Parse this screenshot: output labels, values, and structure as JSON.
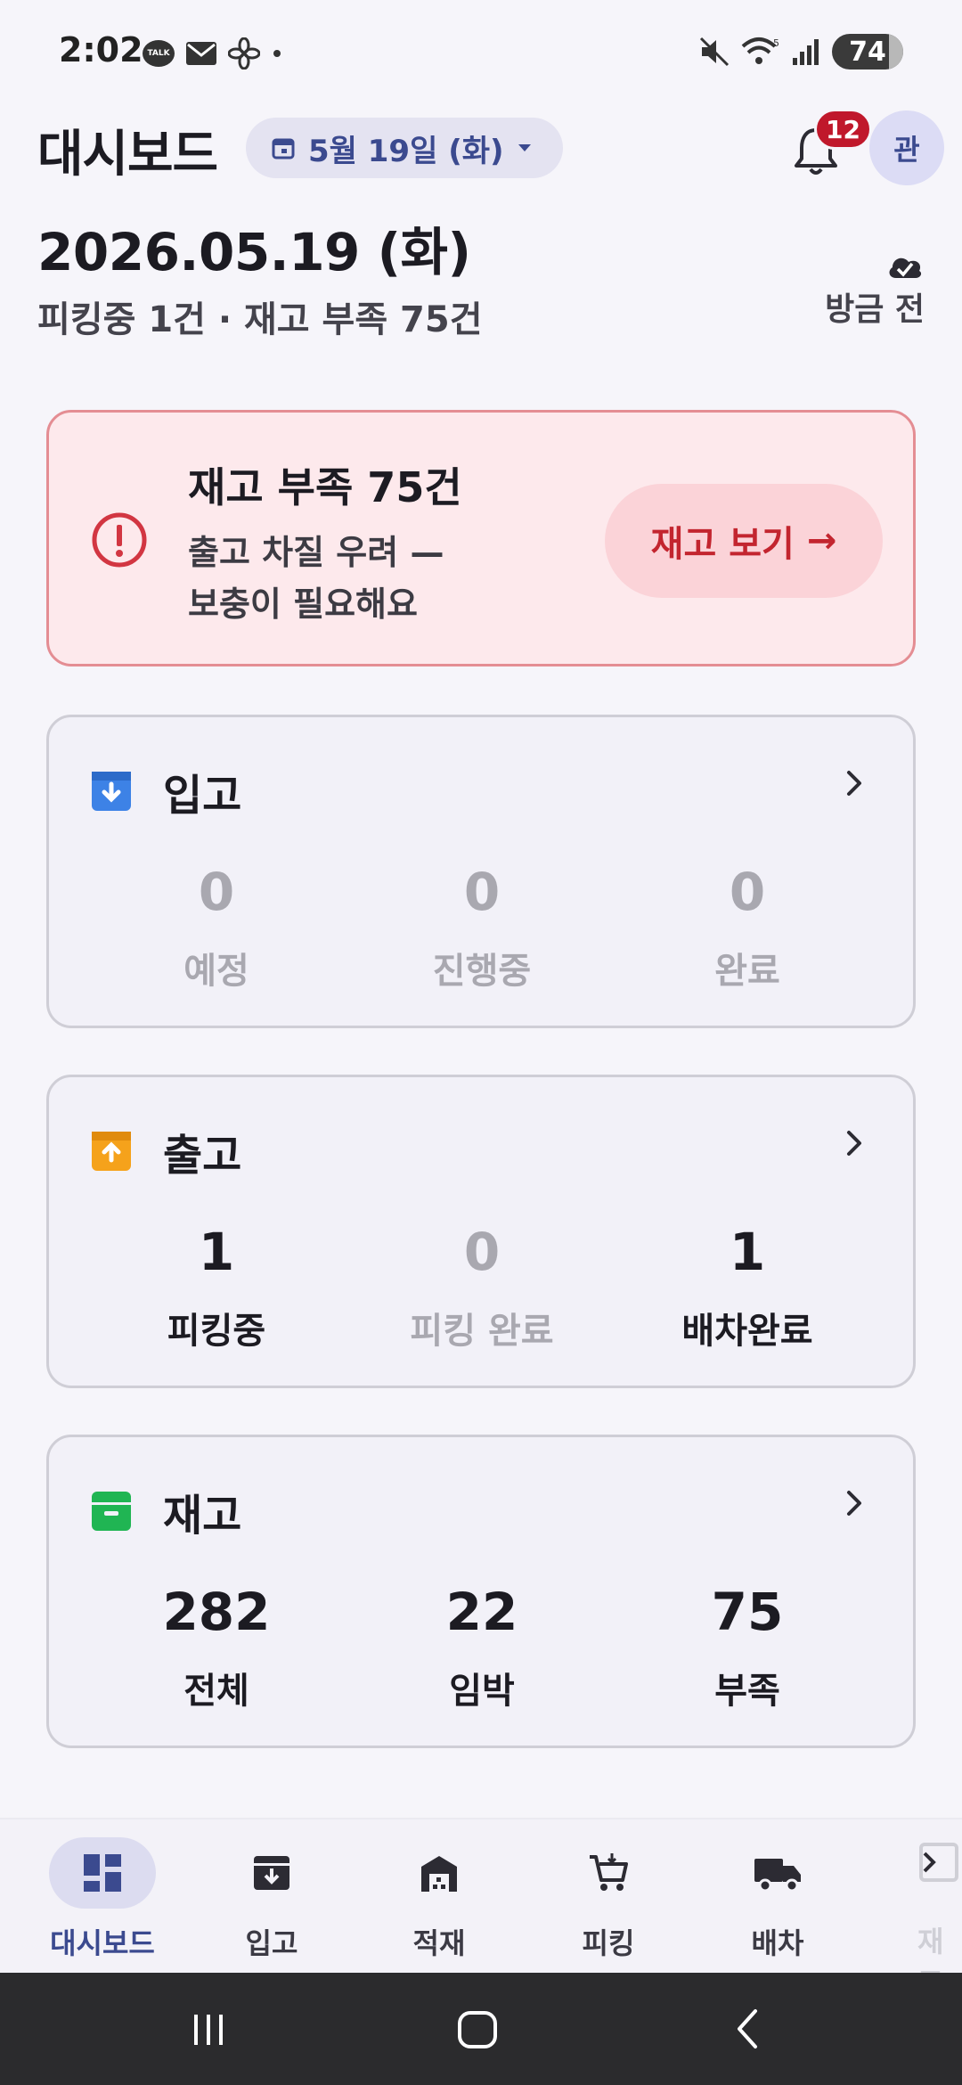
{
  "status_bar": {
    "time": "2:02",
    "talk_label": "TALK",
    "left_icons": [
      "kakaotalk-icon",
      "mail-icon",
      "fan-icon",
      "dot-icon"
    ],
    "right_icons": [
      "mute-icon",
      "wifi-icon",
      "signal-icon"
    ],
    "battery": "74"
  },
  "header": {
    "title": "대시보드",
    "date_chip": "5월 19일 (화)",
    "notification_count": "12",
    "avatar_initial": "관"
  },
  "overview": {
    "date": "2026.05.19 (화)",
    "summary": "피킹중 1건 · 재고 부족 75건",
    "sync_label": "방금 전"
  },
  "alert": {
    "title": "재고 부족 75건",
    "description": "출고 차질 우려 — 보충이 필요해요",
    "button_label": "재고 보기",
    "button_arrow": "→",
    "accent": "#c3252f"
  },
  "sections": {
    "inbound": {
      "title": "입고",
      "icon_color": "#3d82e6",
      "stats": [
        {
          "value": "0",
          "label": "예정"
        },
        {
          "value": "0",
          "label": "진행중"
        },
        {
          "value": "0",
          "label": "완료"
        }
      ]
    },
    "outbound": {
      "title": "출고",
      "icon_color": "#f5a21b",
      "stats": [
        {
          "value": "1",
          "label": "피킹중"
        },
        {
          "value": "0",
          "label": "피킹 완료"
        },
        {
          "value": "1",
          "label": "배차완료"
        }
      ]
    },
    "inventory": {
      "title": "재고",
      "icon_color": "#20b553",
      "stats": [
        {
          "value": "282",
          "label": "전체"
        },
        {
          "value": "22",
          "label": "임박"
        },
        {
          "value": "75",
          "label": "부족"
        }
      ]
    }
  },
  "bottom_nav": {
    "items": [
      {
        "label": "대시보드",
        "icon": "dashboard-icon"
      },
      {
        "label": "입고",
        "icon": "inbound-icon"
      },
      {
        "label": "적재",
        "icon": "warehouse-icon"
      },
      {
        "label": "피킹",
        "icon": "cart-icon"
      },
      {
        "label": "배차",
        "icon": "truck-icon"
      },
      {
        "label": "재고",
        "icon": "inventory-icon"
      }
    ]
  },
  "system_nav": [
    "recents-icon",
    "home-icon",
    "back-icon"
  ]
}
